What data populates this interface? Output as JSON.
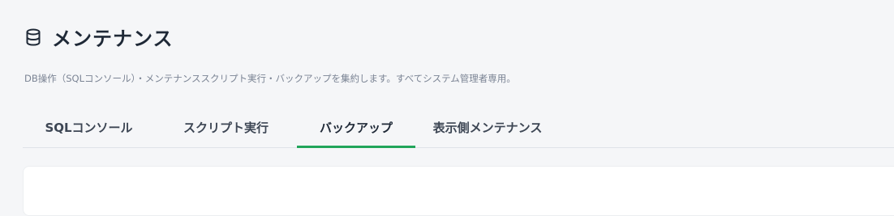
{
  "page": {
    "icon": "database-icon",
    "title": "メンテナンス",
    "subtitle": "DB操作（SQLコンソール）・メンテナンススクリプト実行・バックアップを集約します。すべてシステム管理者専用。"
  },
  "tabs": [
    {
      "label": "SQLコンソール",
      "active": false
    },
    {
      "label": "スクリプト実行",
      "active": false
    },
    {
      "label": "バックアップ",
      "active": true
    },
    {
      "label": "表示側メンテナンス",
      "active": false
    }
  ],
  "colors": {
    "accent": "#22a55a",
    "background": "#f5f6f8",
    "subtitle_text": "#7b8494"
  }
}
